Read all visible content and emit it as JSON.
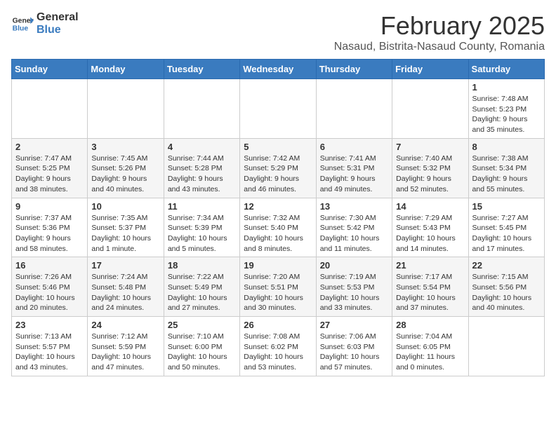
{
  "header": {
    "logo_general": "General",
    "logo_blue": "Blue",
    "month": "February 2025",
    "location": "Nasaud, Bistrita-Nasaud County, Romania"
  },
  "weekdays": [
    "Sunday",
    "Monday",
    "Tuesday",
    "Wednesday",
    "Thursday",
    "Friday",
    "Saturday"
  ],
  "weeks": [
    [
      {
        "day": "",
        "info": ""
      },
      {
        "day": "",
        "info": ""
      },
      {
        "day": "",
        "info": ""
      },
      {
        "day": "",
        "info": ""
      },
      {
        "day": "",
        "info": ""
      },
      {
        "day": "",
        "info": ""
      },
      {
        "day": "1",
        "info": "Sunrise: 7:48 AM\nSunset: 5:23 PM\nDaylight: 9 hours and 35 minutes."
      }
    ],
    [
      {
        "day": "2",
        "info": "Sunrise: 7:47 AM\nSunset: 5:25 PM\nDaylight: 9 hours and 38 minutes."
      },
      {
        "day": "3",
        "info": "Sunrise: 7:45 AM\nSunset: 5:26 PM\nDaylight: 9 hours and 40 minutes."
      },
      {
        "day": "4",
        "info": "Sunrise: 7:44 AM\nSunset: 5:28 PM\nDaylight: 9 hours and 43 minutes."
      },
      {
        "day": "5",
        "info": "Sunrise: 7:42 AM\nSunset: 5:29 PM\nDaylight: 9 hours and 46 minutes."
      },
      {
        "day": "6",
        "info": "Sunrise: 7:41 AM\nSunset: 5:31 PM\nDaylight: 9 hours and 49 minutes."
      },
      {
        "day": "7",
        "info": "Sunrise: 7:40 AM\nSunset: 5:32 PM\nDaylight: 9 hours and 52 minutes."
      },
      {
        "day": "8",
        "info": "Sunrise: 7:38 AM\nSunset: 5:34 PM\nDaylight: 9 hours and 55 minutes."
      }
    ],
    [
      {
        "day": "9",
        "info": "Sunrise: 7:37 AM\nSunset: 5:36 PM\nDaylight: 9 hours and 58 minutes."
      },
      {
        "day": "10",
        "info": "Sunrise: 7:35 AM\nSunset: 5:37 PM\nDaylight: 10 hours and 1 minute."
      },
      {
        "day": "11",
        "info": "Sunrise: 7:34 AM\nSunset: 5:39 PM\nDaylight: 10 hours and 5 minutes."
      },
      {
        "day": "12",
        "info": "Sunrise: 7:32 AM\nSunset: 5:40 PM\nDaylight: 10 hours and 8 minutes."
      },
      {
        "day": "13",
        "info": "Sunrise: 7:30 AM\nSunset: 5:42 PM\nDaylight: 10 hours and 11 minutes."
      },
      {
        "day": "14",
        "info": "Sunrise: 7:29 AM\nSunset: 5:43 PM\nDaylight: 10 hours and 14 minutes."
      },
      {
        "day": "15",
        "info": "Sunrise: 7:27 AM\nSunset: 5:45 PM\nDaylight: 10 hours and 17 minutes."
      }
    ],
    [
      {
        "day": "16",
        "info": "Sunrise: 7:26 AM\nSunset: 5:46 PM\nDaylight: 10 hours and 20 minutes."
      },
      {
        "day": "17",
        "info": "Sunrise: 7:24 AM\nSunset: 5:48 PM\nDaylight: 10 hours and 24 minutes."
      },
      {
        "day": "18",
        "info": "Sunrise: 7:22 AM\nSunset: 5:49 PM\nDaylight: 10 hours and 27 minutes."
      },
      {
        "day": "19",
        "info": "Sunrise: 7:20 AM\nSunset: 5:51 PM\nDaylight: 10 hours and 30 minutes."
      },
      {
        "day": "20",
        "info": "Sunrise: 7:19 AM\nSunset: 5:53 PM\nDaylight: 10 hours and 33 minutes."
      },
      {
        "day": "21",
        "info": "Sunrise: 7:17 AM\nSunset: 5:54 PM\nDaylight: 10 hours and 37 minutes."
      },
      {
        "day": "22",
        "info": "Sunrise: 7:15 AM\nSunset: 5:56 PM\nDaylight: 10 hours and 40 minutes."
      }
    ],
    [
      {
        "day": "23",
        "info": "Sunrise: 7:13 AM\nSunset: 5:57 PM\nDaylight: 10 hours and 43 minutes."
      },
      {
        "day": "24",
        "info": "Sunrise: 7:12 AM\nSunset: 5:59 PM\nDaylight: 10 hours and 47 minutes."
      },
      {
        "day": "25",
        "info": "Sunrise: 7:10 AM\nSunset: 6:00 PM\nDaylight: 10 hours and 50 minutes."
      },
      {
        "day": "26",
        "info": "Sunrise: 7:08 AM\nSunset: 6:02 PM\nDaylight: 10 hours and 53 minutes."
      },
      {
        "day": "27",
        "info": "Sunrise: 7:06 AM\nSunset: 6:03 PM\nDaylight: 10 hours and 57 minutes."
      },
      {
        "day": "28",
        "info": "Sunrise: 7:04 AM\nSunset: 6:05 PM\nDaylight: 11 hours and 0 minutes."
      },
      {
        "day": "",
        "info": ""
      }
    ]
  ]
}
